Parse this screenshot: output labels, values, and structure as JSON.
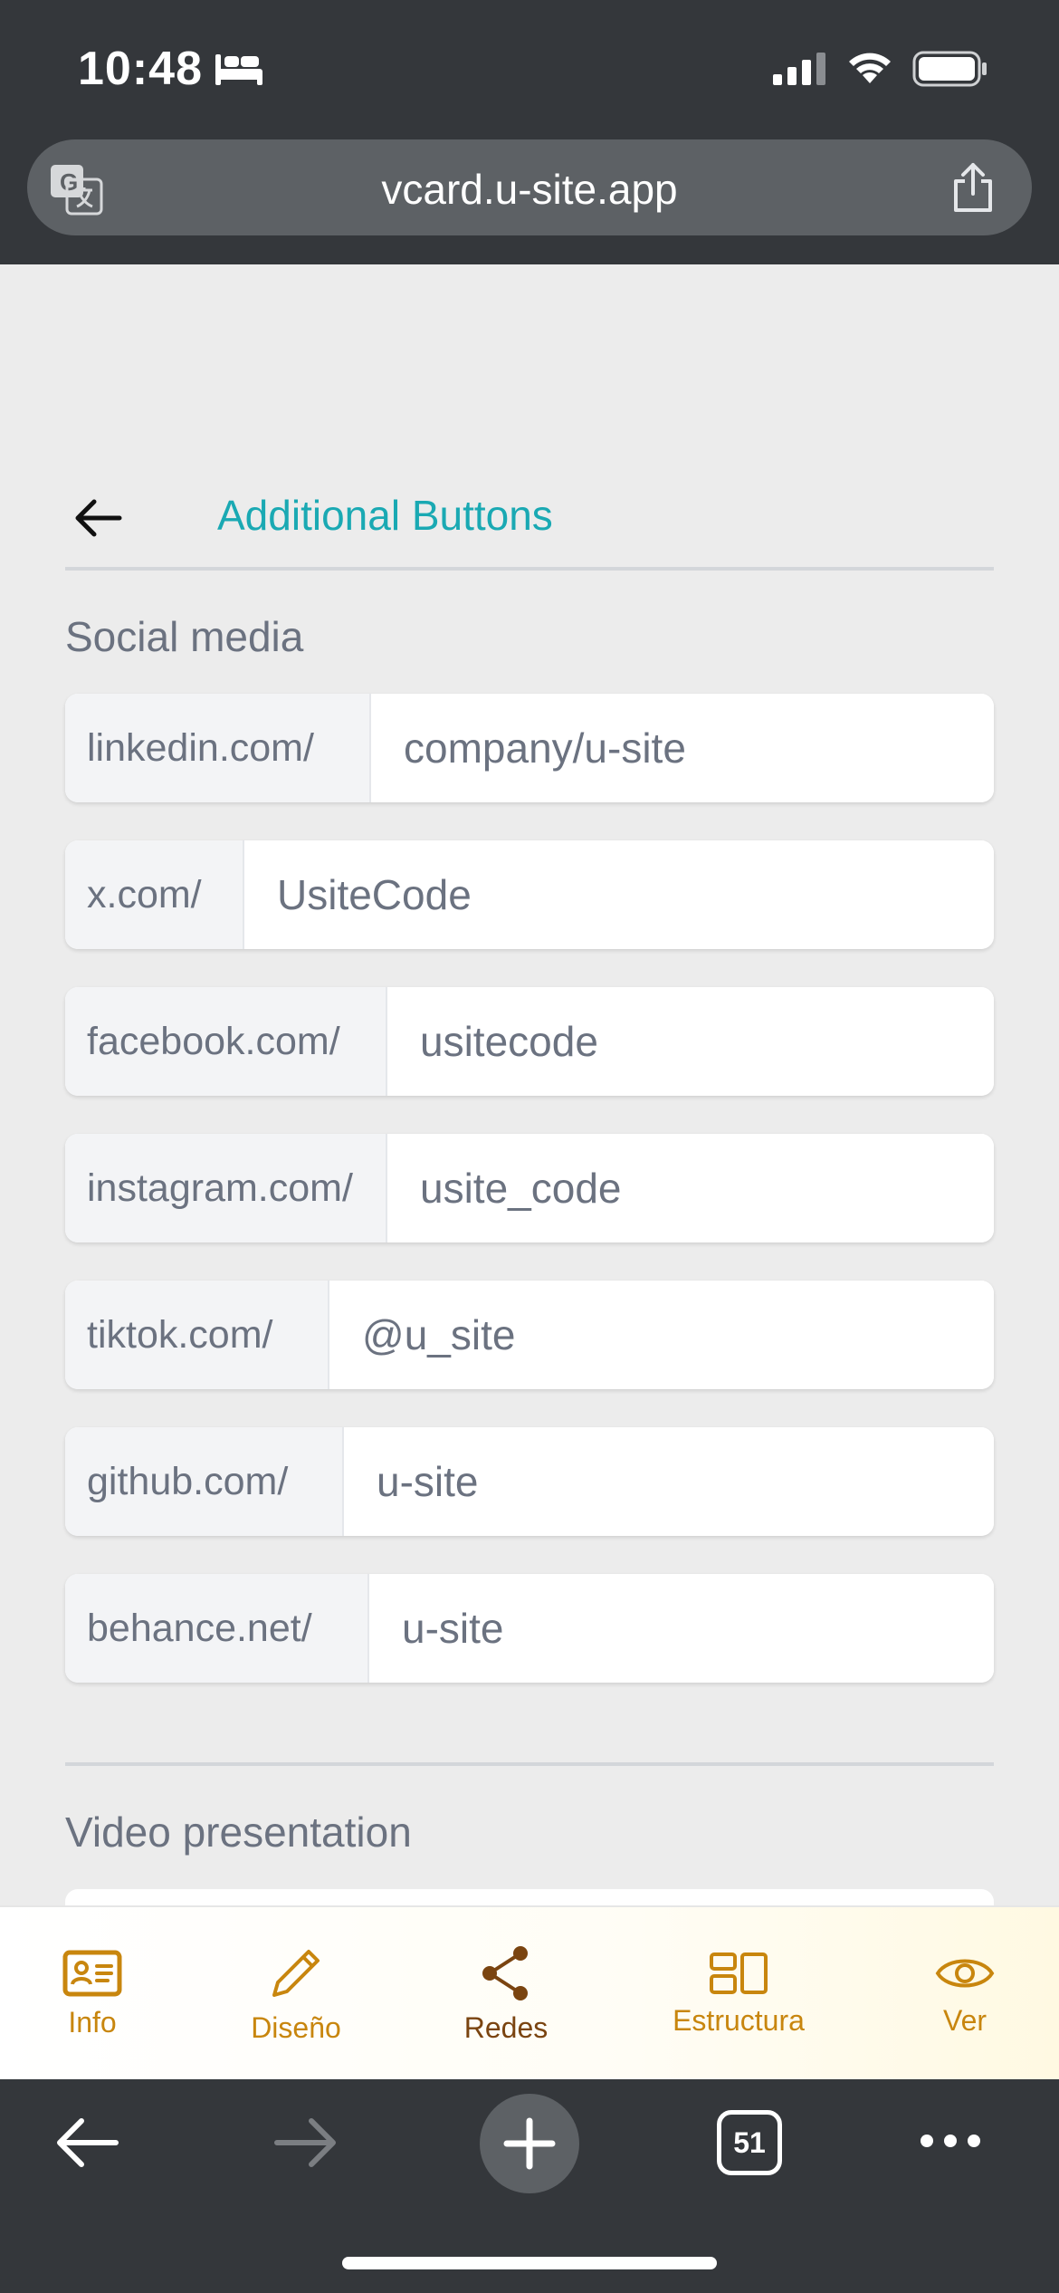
{
  "status_bar": {
    "time": "10:48"
  },
  "browser": {
    "url": "vcard.u-site.app",
    "tab_count": "51"
  },
  "header": {
    "title": "Additional Buttons"
  },
  "social_section": {
    "title": "Social media",
    "rows": [
      {
        "prefix": "linkedin.com/",
        "value": "company/u-site"
      },
      {
        "prefix": "x.com/",
        "value": "UsiteCode"
      },
      {
        "prefix": "facebook.com/",
        "value": "usitecode"
      },
      {
        "prefix": "instagram.com/",
        "value": "usite_code"
      },
      {
        "prefix": "tiktok.com/",
        "value": "@u_site"
      },
      {
        "prefix": "github.com/",
        "value": "u-site"
      },
      {
        "prefix": "behance.net/",
        "value": "u-site"
      }
    ]
  },
  "video_section": {
    "title": "Video presentation"
  },
  "bottom_nav": {
    "items": [
      {
        "label": "Info",
        "icon": "id-card-icon"
      },
      {
        "label": "Diseño",
        "icon": "pencil-icon"
      },
      {
        "label": "Redes",
        "icon": "share-nodes-icon",
        "active": true
      },
      {
        "label": "Estructura",
        "icon": "layout-icon"
      },
      {
        "label": "Ver",
        "icon": "eye-icon"
      }
    ]
  },
  "colors": {
    "accent": "#1aa9b3",
    "nav_gold": "#c8860e",
    "nav_active": "#7a4410",
    "chrome_dark": "#34373b"
  }
}
